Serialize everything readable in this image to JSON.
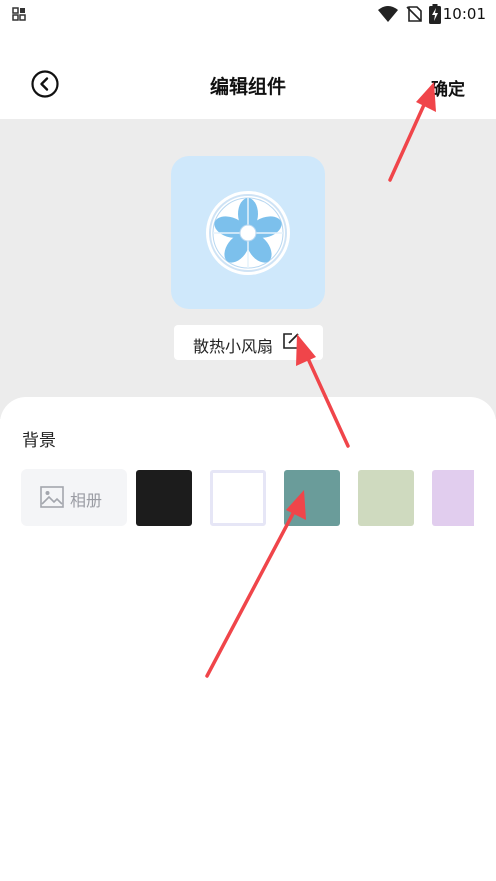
{
  "status_bar": {
    "time": "10:01"
  },
  "header": {
    "title": "编辑组件",
    "confirm_label": "确定"
  },
  "widget": {
    "name": "散热小风扇",
    "card_color": "#cfe8fb"
  },
  "background_section": {
    "label": "背景",
    "album_label": "相册",
    "swatches": [
      "#1c1c1c",
      "#ffffff",
      "#6a9c9a",
      "#cfdabf",
      "#e1cdee"
    ]
  },
  "colors": {
    "annotation_arrow": "#f0454a"
  },
  "icons": [
    "app-grid-icon",
    "wifi-icon",
    "no-sim-icon",
    "battery-charging-icon",
    "back-icon",
    "fan-icon",
    "edit-icon",
    "image-icon"
  ]
}
